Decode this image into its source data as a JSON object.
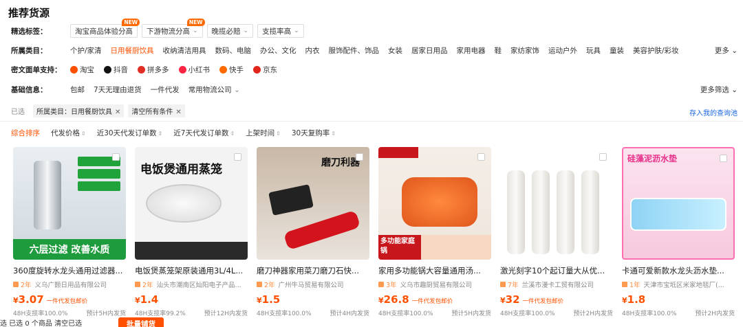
{
  "title": "推荐货源",
  "filter": {
    "label": "精选标签：",
    "chips": [
      {
        "label": "淘宝商品体验分高",
        "new": "NEW",
        "dropdown": false
      },
      {
        "label": "下游物流分高",
        "new": "NEW",
        "dropdown": true
      },
      {
        "label": "晚揽必赔",
        "new": "",
        "dropdown": true
      },
      {
        "label": "支揽率高",
        "new": "",
        "dropdown": true
      }
    ]
  },
  "category": {
    "label": "所属类目：",
    "items": [
      "个护/家清",
      "日用餐厨饮具",
      "收纳清洁用具",
      "数码、电脑",
      "办公、文化",
      "内衣",
      "服饰配件、饰品",
      "女装",
      "居家日用品",
      "家用电器",
      "鞋",
      "家纺家饰",
      "运动户外",
      "玩具",
      "童装",
      "美容护肤/彩妆"
    ],
    "more": "更多"
  },
  "platform": {
    "label": "密文面单支持：",
    "items": [
      {
        "label": "淘宝",
        "color": "#ff5000"
      },
      {
        "label": "抖音",
        "color": "#111111"
      },
      {
        "label": "拼多多",
        "color": "#e02e24"
      },
      {
        "label": "小红书",
        "color": "#ff2442"
      },
      {
        "label": "快手",
        "color": "#ff6a00"
      },
      {
        "label": "京东",
        "color": "#e1251b"
      }
    ]
  },
  "basic": {
    "label": "基础信息：",
    "items": [
      "包邮",
      "7天无理由退货",
      "一件代发",
      "常用物流公司"
    ],
    "more": "更多筛选"
  },
  "selected": {
    "label": "已选",
    "tags": [
      "所属类目：日用餐厨饮具",
      "清空所有条件"
    ],
    "link": "存入我的查询池"
  },
  "sort": [
    "综合排序",
    "代发价格",
    "近30天代发订单数",
    "近7天代发订单数",
    "上架时间",
    "30天复购率"
  ],
  "products": [
    {
      "title": "360度旋转水龙头通用过滤器...",
      "years": "2年",
      "seller": "义乌广颢日用品有限公司",
      "price": "3.07",
      "tag": "一件代发包邮价",
      "rate": "48H支揽率100.0%",
      "ship": "预计5H内发货",
      "img_caption": "六层过滤   改善水质"
    },
    {
      "title": "电饭煲蒸笼架原装通用3L/4L...",
      "years": "2年",
      "seller": "汕头市潮南区灿阳电子产品...",
      "price": "1.4",
      "tag": "",
      "rate": "48H支揽率99.2%",
      "ship": "预计12H内发货",
      "img_caption": "电饭煲通用蒸笼"
    },
    {
      "title": "磨刀神器家用菜刀磨刀石快...",
      "years": "2年",
      "seller": "广州牛马贸易有限公司",
      "price": "1.5",
      "tag": "",
      "rate": "48H支揽率100.0%",
      "ship": "预计4H内发货",
      "img_caption": "磨刀利器"
    },
    {
      "title": "家用多功能锅大容量通用汤...",
      "years": "3年",
      "seller": "义乌市趣厨贸易有限公司",
      "price": "26.8",
      "tag": "一件代发包邮价",
      "rate": "48H支揽率100.0%",
      "ship": "预计5H内发货",
      "img_caption": "多功能家庭锅"
    },
    {
      "title": "激光刻字10个起订量大从优...",
      "years": "7年",
      "seller": "兰溪市漫卡工贸有限公司",
      "price": "32",
      "tag": "一件代发包邮价",
      "rate": "48H支揽率100.0%",
      "ship": "预计2H内发货",
      "img_caption": ""
    },
    {
      "title": "卡通可爱新款水龙头沥水垫...",
      "years": "1年",
      "seller": "天津市宝坻区米家地毯厂(...",
      "price": "1.8",
      "tag": "",
      "rate": "48H支揽率100.0%",
      "ship": "预计2H内发货",
      "img_caption": "硅藻泥沥水垫"
    }
  ],
  "bottom": {
    "text": "选 已选 0 个商品 清空已选",
    "bulk": "批量铺货"
  }
}
